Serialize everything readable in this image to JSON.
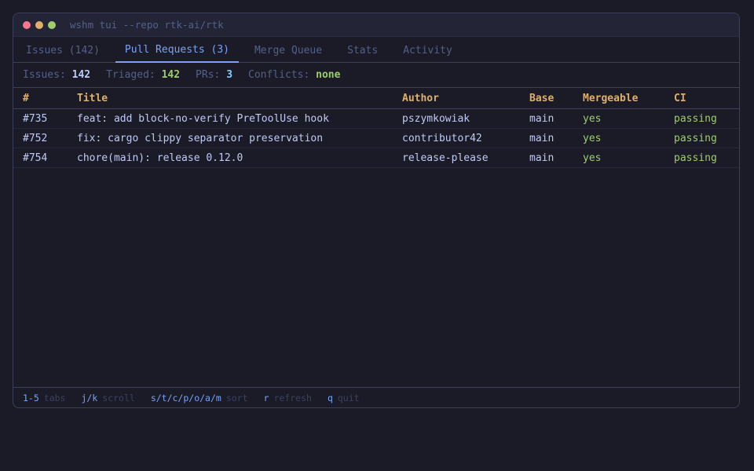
{
  "window": {
    "title": "wshm tui --repo rtk-ai/rtk"
  },
  "tabs": [
    {
      "label": "Issues (142)",
      "active": false
    },
    {
      "label": "Pull Requests (3)",
      "active": true
    },
    {
      "label": "Merge Queue",
      "active": false
    },
    {
      "label": "Stats",
      "active": false
    },
    {
      "label": "Activity",
      "active": false
    }
  ],
  "summary": {
    "issues_label": "Issues:",
    "issues_value": "142",
    "triaged_label": "Triaged:",
    "triaged_value": "142",
    "prs_label": "PRs:",
    "prs_value": "3",
    "conflicts_label": "Conflicts:",
    "conflicts_value": "none"
  },
  "table": {
    "columns": [
      "#",
      "Title",
      "Author",
      "Base",
      "Mergeable",
      "CI"
    ],
    "rows": [
      {
        "num": "#735",
        "title": "feat: add block-no-verify PreToolUse hook",
        "author": "pszymkowiak",
        "base": "main",
        "mergeable": "yes",
        "ci": "passing"
      },
      {
        "num": "#752",
        "title": "fix: cargo clippy separator preservation",
        "author": "contributor42",
        "base": "main",
        "mergeable": "yes",
        "ci": "passing"
      },
      {
        "num": "#754",
        "title": "chore(main): release 0.12.0",
        "author": "release-please",
        "base": "main",
        "mergeable": "yes",
        "ci": "passing"
      }
    ]
  },
  "footer": {
    "hints": [
      {
        "key": "1-5",
        "desc": "tabs"
      },
      {
        "key": "j/k",
        "desc": "scroll"
      },
      {
        "key": "s/t/c/p/o/a/m",
        "desc": "sort"
      },
      {
        "key": "r",
        "desc": "refresh"
      },
      {
        "key": "q",
        "desc": "quit"
      }
    ]
  },
  "colors": {
    "background": "#1a1b26",
    "accent": "#7aa2f7",
    "header": "#e0af68",
    "success": "#9ece6a"
  }
}
